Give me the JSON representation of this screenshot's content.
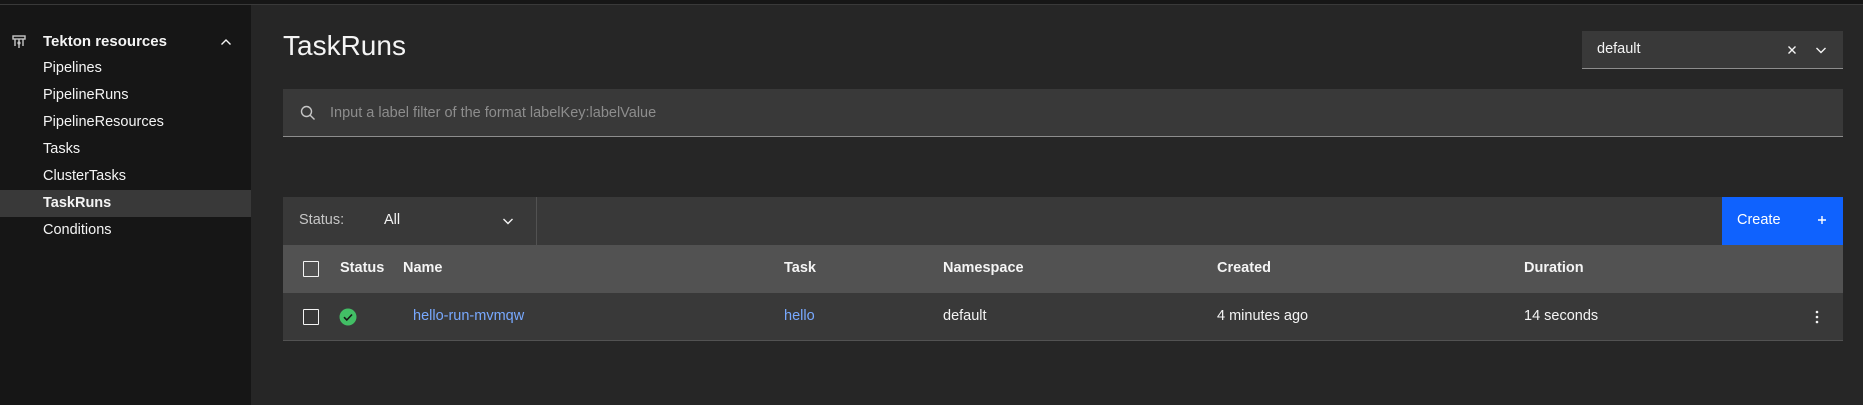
{
  "sidebar": {
    "section_title": "Tekton resources",
    "section_icon": "tekton-logo-icon",
    "items": [
      {
        "label": "Pipelines",
        "active": false
      },
      {
        "label": "PipelineRuns",
        "active": false
      },
      {
        "label": "PipelineResources",
        "active": false
      },
      {
        "label": "Tasks",
        "active": false
      },
      {
        "label": "ClusterTasks",
        "active": false
      },
      {
        "label": "TaskRuns",
        "active": true
      },
      {
        "label": "Conditions",
        "active": false
      }
    ]
  },
  "page": {
    "title": "TaskRuns"
  },
  "namespace_select": {
    "value": "default"
  },
  "label_filter": {
    "placeholder": "Input a label filter of the format labelKey:labelValue",
    "value": ""
  },
  "toolbar": {
    "status_label": "Status:",
    "status_value": "All",
    "create_label": "Create"
  },
  "table": {
    "headers": {
      "status": "Status",
      "name": "Name",
      "task": "Task",
      "namespace": "Namespace",
      "created": "Created",
      "duration": "Duration"
    },
    "rows": [
      {
        "status": "succeeded",
        "name": "hello-run-mvmqw",
        "task": "hello",
        "namespace": "default",
        "created": "4 minutes ago",
        "duration": "14 seconds"
      }
    ]
  },
  "colors": {
    "accent": "#0f62fe",
    "link": "#78a9ff",
    "success": "#42be65",
    "background": "#262626",
    "sidebar": "#161616"
  }
}
